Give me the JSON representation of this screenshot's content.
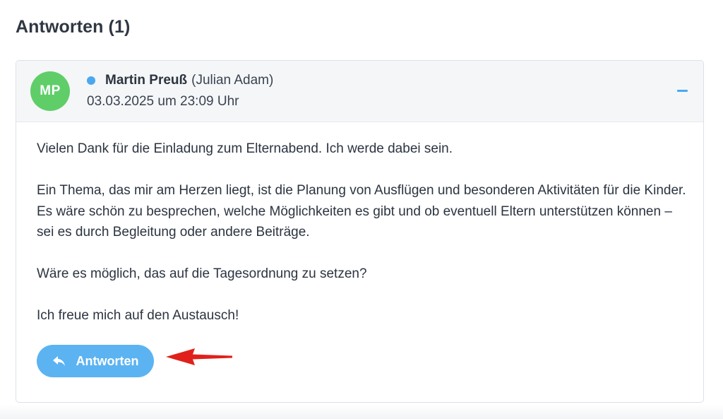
{
  "section": {
    "title": "Antworten (1)"
  },
  "reply": {
    "avatar_initials": "MP",
    "author_name": "Martin Preuß",
    "author_alias": "(Julian Adam)",
    "timestamp": "03.03.2025 um 23:09 Uhr",
    "online_status_color": "#4aa8f0",
    "avatar_color": "#5fce69",
    "paragraphs": [
      "Vielen Dank für die Einladung zum Elternabend. Ich werde dabei sein.",
      "Ein Thema, das mir am Herzen liegt, ist die Planung von Ausflügen und besonderen Aktivitäten für die Kinder. Es wäre schön zu besprechen, welche Möglichkeiten es gibt und ob eventuell Eltern unterstützen können – sei es durch Begleitung oder andere Beiträge.",
      "Wäre es möglich, das auf die Tagesordnung zu setzen?",
      "Ich freue mich auf den Austausch!"
    ],
    "reply_button_label": "Antworten",
    "reply_button_icon": "reply-arrow-icon",
    "collapse_icon": "minus-icon"
  },
  "annotation": {
    "arrow_color": "#e0211b"
  }
}
